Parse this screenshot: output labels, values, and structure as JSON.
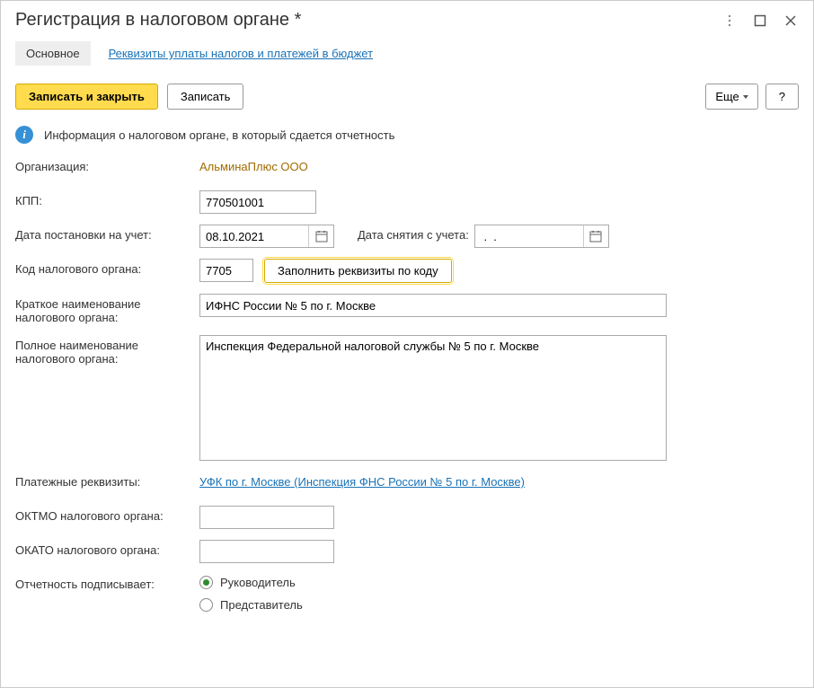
{
  "title": "Регистрация в налоговом органе *",
  "tabs": {
    "main": "Основное",
    "requisites": "Реквизиты уплаты налогов и платежей в бюджет"
  },
  "toolbar": {
    "save_close": "Записать и закрыть",
    "save": "Записать",
    "more": "Еще",
    "help": "?"
  },
  "info_text": "Информация о налоговом органе, в который сдается отчетность",
  "labels": {
    "org": "Организация:",
    "kpp": "КПП:",
    "reg_date": "Дата постановки на учет:",
    "dereg_date": "Дата снятия с учета:",
    "tax_code": "Код налогового органа:",
    "short_name": "Краткое наименование налогового органа:",
    "full_name": "Полное наименование налогового органа:",
    "payment_req": "Платежные реквизиты:",
    "oktmo": "ОКТМО налогового органа:",
    "okato": "ОКАТО налогового органа:",
    "signer": "Отчетность подписывает:",
    "fill_by_code": "Заполнить реквизиты по коду"
  },
  "values": {
    "org": "АльминаПлюс ООО",
    "kpp": "770501001",
    "reg_date": "08.10.2021",
    "dereg_date": " .  . ",
    "tax_code": "7705",
    "short_name": "ИФНС России № 5 по г. Москве",
    "full_name": "Инспекция Федеральной налоговой службы № 5 по г. Москве",
    "payment_req": "УФК по г. Москве (Инспекция ФНС России № 5 по г. Москве)",
    "oktmo": "",
    "okato": ""
  },
  "radio": {
    "head": "Руководитель",
    "rep": "Представитель"
  }
}
